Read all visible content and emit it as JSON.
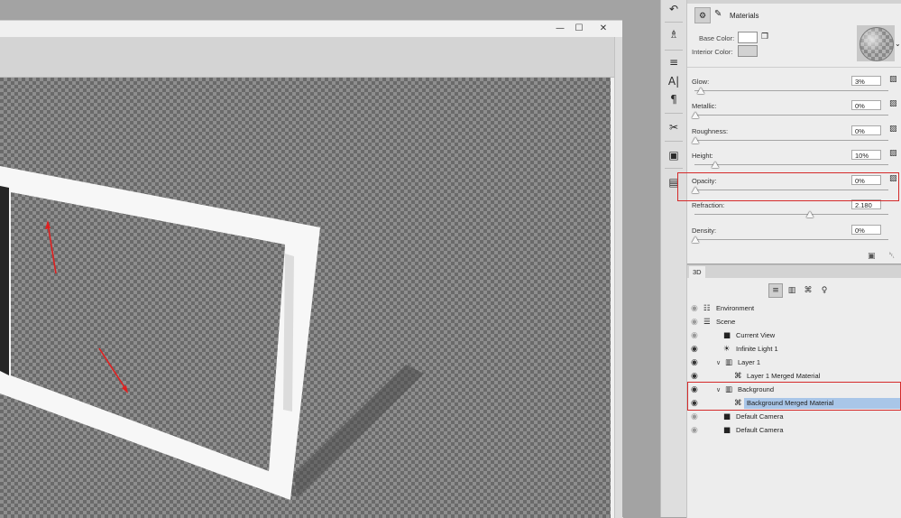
{
  "window_controls": {
    "minimize": "—",
    "restore": "☐",
    "close": "✕"
  },
  "tools": [
    {
      "name": "history-brush-icon",
      "glyph": "↶"
    },
    {
      "name": "stamp-icon",
      "glyph": "♗"
    },
    {
      "name": "adjustments-icon",
      "glyph": "≡"
    },
    {
      "name": "character-icon",
      "glyph": "A|"
    },
    {
      "name": "paragraph-icon",
      "glyph": "¶"
    },
    {
      "name": "tools-icon",
      "glyph": "✂"
    },
    {
      "name": "notes-icon",
      "glyph": "▣"
    },
    {
      "name": "gradient-icon",
      "glyph": "▤"
    }
  ],
  "properties": {
    "header_icon": "⚙",
    "brush_icon": "✎",
    "title": "Materials",
    "base_color_label": "Base Color:",
    "interior_color_label": "Interior Color:",
    "base_color": "#ffffff",
    "interior_color": "#d2d2d2",
    "preview_dropdown": "⌄",
    "folder_glyph": "🗀",
    "sliders": [
      {
        "label": "Glow:",
        "value": "3%",
        "level": 0.03
      },
      {
        "label": "Metallic:",
        "value": "0%",
        "level": 0.0
      },
      {
        "label": "Roughness:",
        "value": "0%",
        "level": 0.0
      },
      {
        "label": "Height:",
        "value": "10%",
        "level": 0.1
      },
      {
        "label": "Opacity:",
        "value": "0%",
        "level": 0.0
      },
      {
        "label": "Refraction:",
        "value": "2.180",
        "level": 0.59
      },
      {
        "label": "Density:",
        "value": "0%",
        "level": 0.0
      }
    ],
    "bottom_icons": "▣   ␡"
  },
  "panel3d": {
    "tab_label": "3D",
    "filters": [
      "≡",
      "▥",
      "⌘",
      "♀"
    ],
    "rows": [
      {
        "name": "Environment",
        "icon": "☷",
        "eye": "dim",
        "indent": 0,
        "twisty": ""
      },
      {
        "name": "Scene",
        "icon": "☰",
        "eye": "dim",
        "indent": 0,
        "twisty": ""
      },
      {
        "name": "Current View",
        "icon": "■",
        "eye": "dim",
        "indent": 1,
        "twisty": ""
      },
      {
        "name": "Infinite Light 1",
        "icon": "☀",
        "eye": "on",
        "indent": 1,
        "twisty": ""
      },
      {
        "name": "Layer 1",
        "icon": "▥",
        "eye": "on",
        "indent": 1,
        "twisty": "∨"
      },
      {
        "name": "Layer 1 Merged Material",
        "icon": "⌘",
        "eye": "on",
        "indent": 2,
        "twisty": ""
      },
      {
        "name": "Background",
        "icon": "▥",
        "eye": "on",
        "indent": 1,
        "twisty": "∨"
      },
      {
        "name": "Background Merged Material",
        "icon": "⌘",
        "eye": "on",
        "indent": 2,
        "twisty": "",
        "selected": true
      },
      {
        "name": "Default Camera",
        "icon": "■",
        "eye": "dim",
        "indent": 1,
        "twisty": ""
      },
      {
        "name": "Default Camera",
        "icon": "■",
        "eye": "dim",
        "indent": 1,
        "twisty": ""
      }
    ]
  }
}
